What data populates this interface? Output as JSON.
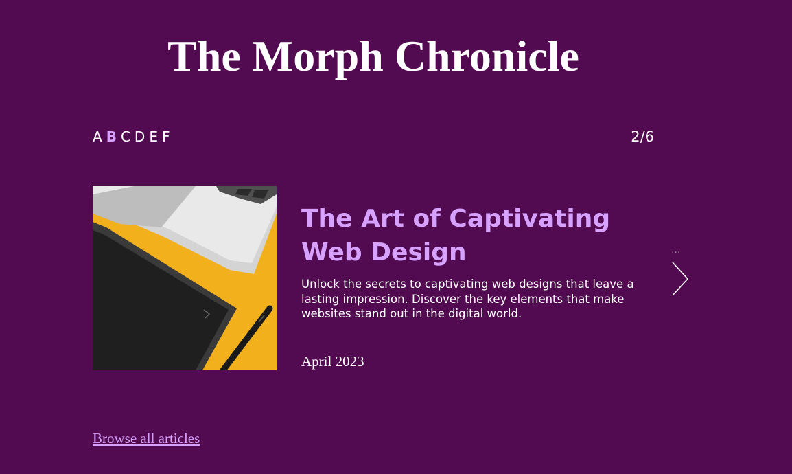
{
  "site": {
    "title": "The Morph Chronicle"
  },
  "nav": {
    "letters": [
      "A",
      "B",
      "C",
      "D",
      "E",
      "F"
    ],
    "active_index": 1,
    "counter": "2/6"
  },
  "article": {
    "image_alt": "Laptop and drawing tablet with stylus on yellow background",
    "headline": "The Art of Captivating Web Design",
    "summary": "Unlock the secrets to captivating web designs that leave a lasting impression. Discover the key elements that make websites stand out in the digital world.",
    "date": "April 2023"
  },
  "controls": {
    "more_label": "...",
    "next_icon": "chevron-right-icon"
  },
  "footer": {
    "browse_link": "Browse all articles"
  },
  "colors": {
    "background": "#520a50",
    "accent": "#d6a1ff",
    "text": "#ffffff"
  }
}
